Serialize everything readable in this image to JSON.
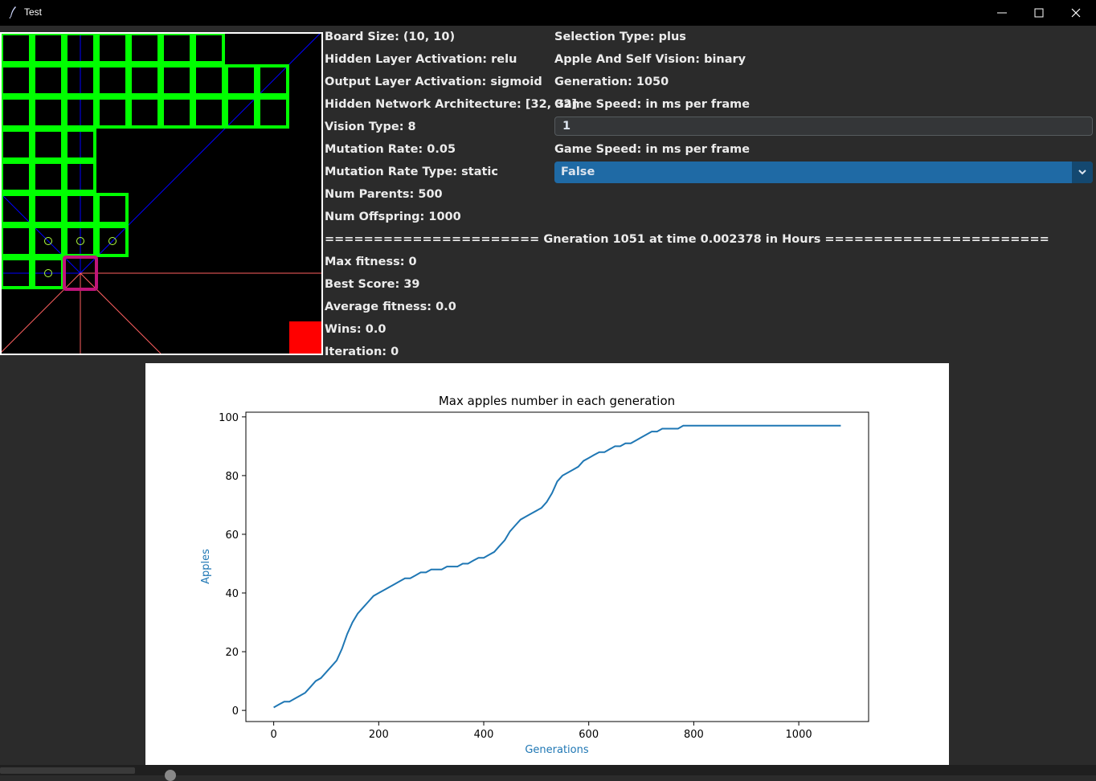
{
  "window": {
    "title": "Test",
    "controls": [
      "minimize",
      "maximize",
      "close"
    ]
  },
  "board": {
    "background": "#000000",
    "border_color": "#ffffff",
    "snake_color": "#00ff00",
    "head_color": "#c0157a",
    "apple_color": "#ff0000",
    "vision_line_color": "#0000ff",
    "wall_ray_color": "#ff6060",
    "marker_color": "#b0ff40"
  },
  "params": {
    "board_size": "Board Size: (10, 10)",
    "hidden_activation": "Hidden Layer Activation: relu",
    "output_activation": "Output Layer Activation: sigmoid",
    "architecture": "Hidden Network Architecture: [32, 32]",
    "vision_type": "Vision Type: 8",
    "mutation_rate": "Mutation Rate: 0.05",
    "mutation_rate_type": "Mutation Rate Type: static",
    "num_parents": "Num Parents: 500",
    "num_offspring": "Num Offspring: 1000",
    "selection_type": "Selection Type: plus",
    "apple_self_vision": "Apple And Self Vision: binary",
    "generation": "Generation: 1050",
    "game_speed_label_1": "Game Speed: in ms per frame",
    "game_speed_label_2": "Game Speed: in ms per frame"
  },
  "controls": {
    "speed_input_value": "1",
    "dropdown_value": "False",
    "dropdown_color": "#1f6aa5"
  },
  "status": {
    "generation_banner": "====================== Gneration 1051 at time 0.002378 in Hours =======================",
    "max_fitness": "Max fitness: 0",
    "best_score": "Best Score: 39",
    "average_fitness": "Average fitness: 0.0",
    "wins": "Wins: 0.0",
    "iteration": "Iteration: 0"
  },
  "chart_data": {
    "type": "line",
    "title": "Max apples number in each generation",
    "xlabel": "Generations",
    "ylabel": "Apples",
    "xlim": [
      -53,
      1133
    ],
    "ylim": [
      -3.8,
      101.6
    ],
    "xticks": [
      0,
      200,
      400,
      600,
      800,
      1000
    ],
    "yticks": [
      0,
      20,
      40,
      60,
      80,
      100
    ],
    "grid": false,
    "line_color": "#1f77b4",
    "label_color": "#1f77b4",
    "series": [
      {
        "points": [
          [
            0,
            1
          ],
          [
            10,
            2
          ],
          [
            20,
            3
          ],
          [
            30,
            3
          ],
          [
            40,
            4
          ],
          [
            50,
            5
          ],
          [
            60,
            6
          ],
          [
            70,
            8
          ],
          [
            80,
            10
          ],
          [
            90,
            11
          ],
          [
            100,
            13
          ],
          [
            110,
            15
          ],
          [
            120,
            17
          ],
          [
            130,
            21
          ],
          [
            140,
            26
          ],
          [
            150,
            30
          ],
          [
            160,
            33
          ],
          [
            170,
            35
          ],
          [
            180,
            37
          ],
          [
            190,
            39
          ],
          [
            200,
            40
          ],
          [
            210,
            41
          ],
          [
            220,
            42
          ],
          [
            230,
            43
          ],
          [
            240,
            44
          ],
          [
            250,
            45
          ],
          [
            260,
            45
          ],
          [
            270,
            46
          ],
          [
            280,
            47
          ],
          [
            290,
            47
          ],
          [
            300,
            48
          ],
          [
            310,
            48
          ],
          [
            320,
            48
          ],
          [
            330,
            49
          ],
          [
            340,
            49
          ],
          [
            350,
            49
          ],
          [
            360,
            50
          ],
          [
            370,
            50
          ],
          [
            380,
            51
          ],
          [
            390,
            52
          ],
          [
            400,
            52
          ],
          [
            410,
            53
          ],
          [
            420,
            54
          ],
          [
            430,
            56
          ],
          [
            440,
            58
          ],
          [
            450,
            61
          ],
          [
            460,
            63
          ],
          [
            470,
            65
          ],
          [
            480,
            66
          ],
          [
            490,
            67
          ],
          [
            500,
            68
          ],
          [
            510,
            69
          ],
          [
            520,
            71
          ],
          [
            530,
            74
          ],
          [
            540,
            78
          ],
          [
            550,
            80
          ],
          [
            560,
            81
          ],
          [
            570,
            82
          ],
          [
            580,
            83
          ],
          [
            590,
            85
          ],
          [
            600,
            86
          ],
          [
            610,
            87
          ],
          [
            620,
            88
          ],
          [
            630,
            88
          ],
          [
            640,
            89
          ],
          [
            650,
            90
          ],
          [
            660,
            90
          ],
          [
            670,
            91
          ],
          [
            680,
            91
          ],
          [
            690,
            92
          ],
          [
            700,
            93
          ],
          [
            710,
            94
          ],
          [
            720,
            95
          ],
          [
            730,
            95
          ],
          [
            740,
            96
          ],
          [
            750,
            96
          ],
          [
            760,
            96
          ],
          [
            770,
            96
          ],
          [
            780,
            97
          ],
          [
            790,
            97
          ],
          [
            800,
            97
          ],
          [
            820,
            97
          ],
          [
            840,
            97
          ],
          [
            860,
            97
          ],
          [
            880,
            97
          ],
          [
            900,
            97
          ],
          [
            950,
            97
          ],
          [
            1000,
            97
          ],
          [
            1050,
            97
          ],
          [
            1080,
            97
          ]
        ]
      }
    ]
  }
}
